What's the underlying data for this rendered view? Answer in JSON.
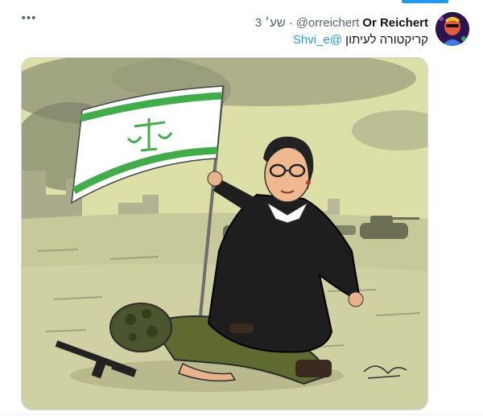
{
  "tweet": {
    "author_name": "Or Reichert",
    "author_handle": "@orreichert",
    "separator": "·",
    "time": "3 שע׳",
    "text": "קריקטורה לעיתון",
    "mention": "@Shvi_e",
    "more_label": "•••"
  },
  "media": {
    "kind": "cartoon-illustration",
    "description_icon": "caricature-image"
  },
  "colors": {
    "accent": "#1d9bf0",
    "text": "#0f1419",
    "secondary": "#536471",
    "flag_green": "#3fae49",
    "sky": "#dadea0"
  }
}
